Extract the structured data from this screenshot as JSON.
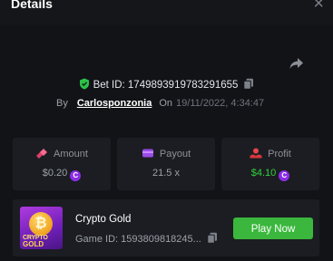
{
  "header": {
    "title": "Details",
    "close_symbol": "×"
  },
  "bet": {
    "id_text": "Bet ID: 1749893919783291655",
    "by_label": "By",
    "username": "Carlosponzonia",
    "on_label": "On",
    "date": "19/11/2022, 4:34:47"
  },
  "stats": {
    "amount": {
      "label": "Amount",
      "value": "$0.20",
      "coin": "C"
    },
    "payout": {
      "label": "Payout",
      "value": "21.5 x"
    },
    "profit": {
      "label": "Profit",
      "value": "$4.10",
      "coin": "C"
    }
  },
  "game": {
    "name": "Crypto Gold",
    "id_text": "Game ID: 1593809818245...",
    "thumb_symbol": "₿",
    "thumb_line1": "CRYPTO",
    "thumb_line2": "GOLD",
    "play_label": "Play Now"
  },
  "colors": {
    "accent_green": "#3ab73c",
    "profit_green": "#35d23c",
    "coin_purple": "#8b2de6"
  }
}
